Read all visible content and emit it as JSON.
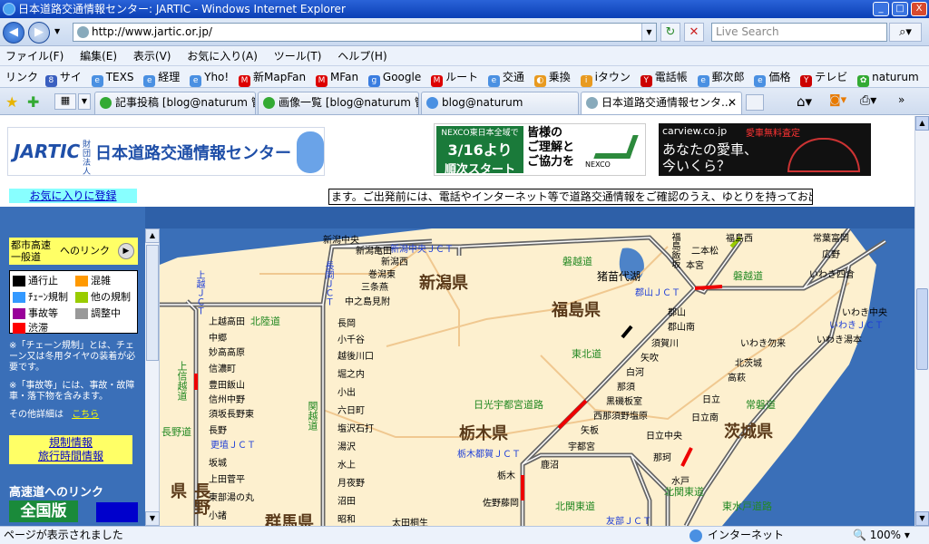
{
  "window": {
    "title": "日本道路交通情報センター: JARTIC - Windows Internet Explorer",
    "min": "_",
    "max": "□",
    "close": "X"
  },
  "address": {
    "url": "http://www.jartic.or.jp/",
    "search_placeholder": "Live Search"
  },
  "menu": [
    "ファイル(F)",
    "編集(E)",
    "表示(V)",
    "お気に入り(A)",
    "ツール(T)",
    "ヘルプ(H)"
  ],
  "links": {
    "label": "リンク",
    "items": [
      {
        "label": "サイ"
      },
      {
        "label": "TEXS"
      },
      {
        "label": "経理"
      },
      {
        "label": "Yho!"
      },
      {
        "label": "新MapFan"
      },
      {
        "label": "MFan"
      },
      {
        "label": "Google"
      },
      {
        "label": "ルート"
      },
      {
        "label": "交通"
      },
      {
        "label": "乗換"
      },
      {
        "label": "iタウン"
      },
      {
        "label": "電話帳"
      },
      {
        "label": "郵次郎"
      },
      {
        "label": "価格"
      },
      {
        "label": "テレビ"
      },
      {
        "label": "naturum"
      }
    ]
  },
  "tabs": [
    {
      "label": "記事投稿 [blog@naturum 管..."
    },
    {
      "label": "画像一覧 [blog@naturum 管..."
    },
    {
      "label": "blog@naturum"
    },
    {
      "label": "日本道路交通情報センタ..."
    }
  ],
  "status": {
    "text": "ページが表示されました",
    "zone": "インターネット",
    "zoom": "100%"
  },
  "page": {
    "logo_text": "JARTIC",
    "logo_name": "日本道路交通情報センター",
    "logo_sub": "財団法人",
    "ad1": {
      "line1": "NEXCO東日本全域で",
      "line2": "3/16より",
      "line3": "順次スタート",
      "line4": "皆様の",
      "line5": "ご理解と",
      "line6": "ご協力を",
      "brand": "NEXCO"
    },
    "ad2": {
      "site": "carview.co.jp",
      "tag": "愛車無料査定",
      "line1": "あなたの愛車、",
      "line2": "今いくら？"
    },
    "fav_link": "お気に入りに登録",
    "ticker": "ます。ご出発前には、電話やインターネット等で道路交通情報をご確認のうえ、ゆとりを持ってお出掛け下さ",
    "city_link": {
      "line1": "都市高速",
      "line2": "一般道",
      "line3": "へのリンク"
    },
    "legend": [
      {
        "label": "通行止",
        "color": "#000000"
      },
      {
        "label": "混雑",
        "color": "#ff9900"
      },
      {
        "label": "ﾁｪｰﾝ規制",
        "color": "#3399ff"
      },
      {
        "label": "他の規制",
        "color": "#99cc00"
      },
      {
        "label": "事故等",
        "color": "#990099"
      },
      {
        "label": "調整中",
        "color": "#999999"
      },
      {
        "label": "渋滞",
        "color": "#ff0000"
      }
    ],
    "note1": "※「チェーン規制」とは、チェーン又は冬用タイヤの装着が必要です。",
    "note2": "※「事故等」には、事故・故障車・落下物を含みます。",
    "other_detail": "その他詳細は",
    "other_link": "こちら",
    "kisei_line1": "規制情報",
    "kisei_line2": "旅行時間情報",
    "highway_link": "高速道へのリンク",
    "zenkoku": "全国版"
  },
  "map": {
    "prefectures": [
      "新潟県",
      "福島県",
      "栃木県",
      "茨城県",
      "長野県",
      "群馬県"
    ],
    "routes": [
      "北陸道",
      "関越道",
      "磐越道",
      "東北道",
      "常磐道",
      "北関東道",
      "上信越道",
      "長野道",
      "日光宇都宮道路",
      "東水戸道路"
    ],
    "jcts": [
      "新潟中央ＪＣＴ",
      "長岡ＪＣＴ",
      "郡山ＪＣＴ",
      "いわきＪＣＴ",
      "更埴ＪＣＴ",
      "栃木都賀ＪＣＴ",
      "上越ＪＣＴ",
      "友部ＪＣＴ"
    ],
    "places": [
      "新潟中央",
      "新潟西",
      "新潟亀田",
      "巻潟東",
      "三条燕",
      "中之島見附",
      "長岡",
      "小千谷",
      "越後川口",
      "堀之内",
      "小出",
      "六日町",
      "塩沢石打",
      "湯沢",
      "水上",
      "月夜野",
      "沼田",
      "昭和",
      "猪苗代湖",
      "本宮",
      "二本松",
      "福島西",
      "福島飯坂",
      "郡山",
      "郡山南",
      "須賀川",
      "矢吹",
      "白河",
      "那須",
      "黒磯板室",
      "西那須野塩原",
      "矢板",
      "宇都宮",
      "鹿沼",
      "栃木",
      "佐野藤岡",
      "日立",
      "日立南",
      "日立中央",
      "那珂",
      "水戸",
      "いわき中央",
      "いわき湯本",
      "いわき勿来",
      "北茨城",
      "高萩",
      "広野",
      "常葉富岡",
      "いわき四倉",
      "上越高田",
      "中郷",
      "妙高高原",
      "信濃町",
      "豊田飯山",
      "信州中野",
      "須坂長野東",
      "長野",
      "坂城",
      "上田菅平",
      "東部湯の丸",
      "小諸",
      "太田桐生"
    ]
  }
}
